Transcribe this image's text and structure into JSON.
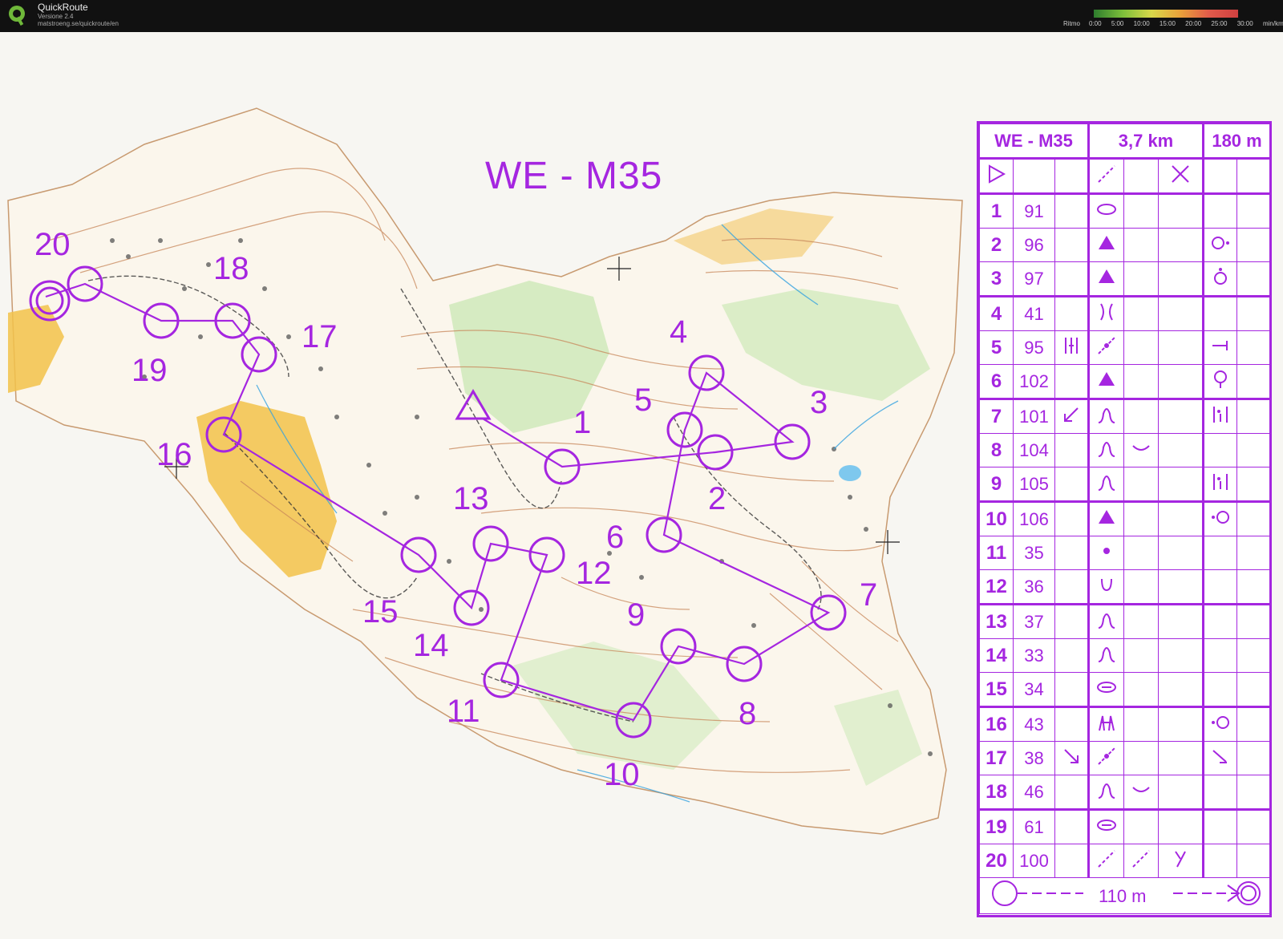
{
  "app": {
    "title": "QuickRoute",
    "version": "Versione 2.4",
    "url": "matstroeng.se/quickroute/en"
  },
  "pace_scale": {
    "label": "Ritmo",
    "ticks": [
      "0:00",
      "5:00",
      "10:00",
      "15:00",
      "20:00",
      "25:00",
      "30:00"
    ],
    "unit": "min/km"
  },
  "map": {
    "title": "WE - M35",
    "course_color": "#a526e0",
    "controls": [
      {
        "n": "1",
        "label": "1"
      },
      {
        "n": "2",
        "label": "2"
      },
      {
        "n": "3",
        "label": "3"
      },
      {
        "n": "4",
        "label": "4"
      },
      {
        "n": "5",
        "label": "5"
      },
      {
        "n": "6",
        "label": "6"
      },
      {
        "n": "7",
        "label": "7"
      },
      {
        "n": "8",
        "label": "8"
      },
      {
        "n": "9",
        "label": "9"
      },
      {
        "n": "10",
        "label": "10"
      },
      {
        "n": "11",
        "label": "11"
      },
      {
        "n": "12",
        "label": "12"
      },
      {
        "n": "13",
        "label": "13"
      },
      {
        "n": "14",
        "label": "14"
      },
      {
        "n": "15",
        "label": "15"
      },
      {
        "n": "16",
        "label": "16"
      },
      {
        "n": "17",
        "label": "17"
      },
      {
        "n": "18",
        "label": "18"
      },
      {
        "n": "19",
        "label": "19"
      },
      {
        "n": "20",
        "label": "20"
      }
    ]
  },
  "description_sheet": {
    "course": "WE - M35",
    "length": "3,7 km",
    "climb": "180 m",
    "finish_distance": "110 m",
    "rows": [
      {
        "num": "1",
        "code": "91",
        "c": "",
        "d": "oval-icon",
        "e": "",
        "f": "",
        "g": ""
      },
      {
        "num": "2",
        "code": "96",
        "c": "",
        "d": "triangle-icon",
        "e": "",
        "f": "",
        "g": "circle-dot-right-icon"
      },
      {
        "num": "3",
        "code": "97",
        "c": "",
        "d": "triangle-icon",
        "e": "",
        "f": "",
        "g": "circle-dot-top-icon"
      },
      {
        "num": "4",
        "code": "41",
        "c": "",
        "d": "gully-icon",
        "e": "",
        "f": "",
        "g": ""
      },
      {
        "num": "5",
        "code": "95",
        "c": "bars-icon",
        "d": "path-icon",
        "e": "",
        "f": "",
        "g": "end-icon"
      },
      {
        "num": "6",
        "code": "102",
        "c": "",
        "d": "triangle-icon",
        "e": "",
        "f": "",
        "g": "circle-dot-bottom-icon"
      },
      {
        "num": "7",
        "code": "101",
        "c": "arrow-sw-icon",
        "d": "knoll-icon",
        "e": "",
        "f": "",
        "g": "between-icon"
      },
      {
        "num": "8",
        "code": "104",
        "c": "",
        "d": "knoll-icon",
        "e": "depression-icon",
        "f": "",
        "g": ""
      },
      {
        "num": "9",
        "code": "105",
        "c": "",
        "d": "knoll-icon",
        "e": "",
        "f": "",
        "g": "between-icon"
      },
      {
        "num": "10",
        "code": "106",
        "c": "",
        "d": "triangle-icon",
        "e": "",
        "f": "",
        "g": "circle-dot-left-icon"
      },
      {
        "num": "11",
        "code": "35",
        "c": "",
        "d": "dot-icon",
        "e": "",
        "f": "",
        "g": ""
      },
      {
        "num": "12",
        "code": "36",
        "c": "",
        "d": "cup-icon",
        "e": "",
        "f": "",
        "g": ""
      },
      {
        "num": "13",
        "code": "37",
        "c": "",
        "d": "knoll-icon",
        "e": "",
        "f": "",
        "g": ""
      },
      {
        "num": "14",
        "code": "33",
        "c": "",
        "d": "knoll-icon",
        "e": "",
        "f": "",
        "g": ""
      },
      {
        "num": "15",
        "code": "34",
        "c": "",
        "d": "oval-bar-icon",
        "e": "",
        "f": "",
        "g": ""
      },
      {
        "num": "16",
        "code": "43",
        "c": "",
        "d": "root-icon",
        "e": "",
        "f": "",
        "g": "circle-dot-left-icon"
      },
      {
        "num": "17",
        "code": "38",
        "c": "arrow-se-icon",
        "d": "path-icon",
        "e": "",
        "f": "",
        "g": "corner-icon"
      },
      {
        "num": "18",
        "code": "46",
        "c": "",
        "d": "knoll-icon",
        "e": "depression-icon",
        "f": "",
        "g": ""
      },
      {
        "num": "19",
        "code": "61",
        "c": "",
        "d": "oval-bar-icon",
        "e": "",
        "f": "",
        "g": ""
      },
      {
        "num": "20",
        "code": "100",
        "c": "",
        "d": "dash-slash-icon",
        "e": "dash-slash-icon",
        "f": "y-icon",
        "g": ""
      }
    ]
  }
}
